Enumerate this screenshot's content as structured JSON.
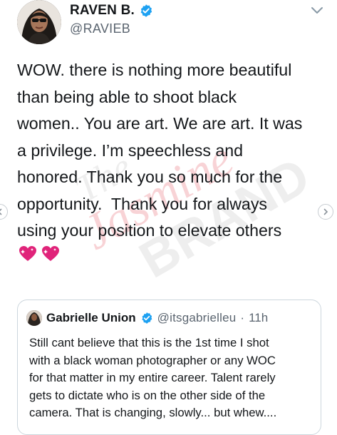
{
  "tweet": {
    "display_name": "RAVEN B.",
    "handle": "@RAVIEB",
    "text": "WOW. there is nothing more beautiful\nthan being able to shoot black\nwomen.. You are art. We are art. It was\na privilege. I’m speechless and\nhonored. Thank you so much for the\nopportunity.  Thank you for always\nusing your position to elevate others",
    "emojis": [
      "sparkling-heart",
      "sparkling-heart"
    ]
  },
  "quote": {
    "display_name": "Gabrielle Union",
    "handle": "@itsgabrielleu",
    "separator": "·",
    "time": "11h",
    "text": "Still cant believe that this is the 1st time I shot\nwith a black woman photographer or any WOC\nfor that matter in my entire career. Talent rarely\ngets to dictate who is on the other side of the\ncamera. That is changing, slowly... but whew...."
  },
  "watermark": {
    "line1": "The",
    "line2": "Jasmine",
    "line3": "BRAND"
  },
  "colors": {
    "text": "#14171a",
    "muted": "#5b6570",
    "verified": "#1da1f2",
    "emoji": "#e0247a",
    "border": "#ccd6dd",
    "watermark_red": "#e23b4a",
    "watermark_gray": "#b7b7b7"
  }
}
